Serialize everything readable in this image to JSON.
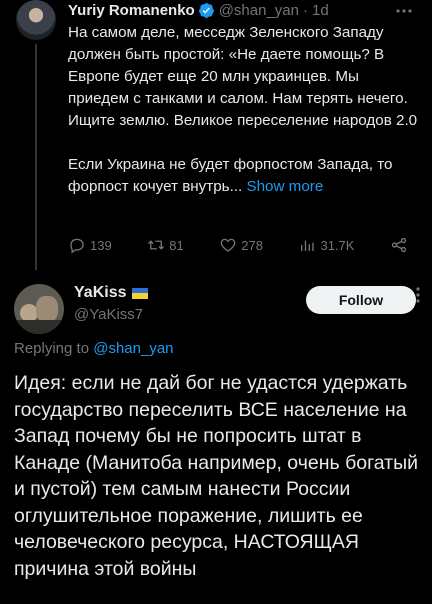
{
  "parent_tweet": {
    "author_name": "Yuriy Romanenko",
    "handle": "@shan_yan",
    "separator": "·",
    "time": "1d",
    "paragraph1": "На самом деле,  месседж Зеленского Западу должен быть простой: «Не даете помощь? В Европе будет еще 20 млн украинцев. Мы приедем с танками и салом. Нам терять нечего. Ищите землю. Великое переселение народов 2.0",
    "paragraph2": "Если Украина не будет форпостом Запада, то форпост кочует внутрь...",
    "show_more_label": "Show more",
    "actions": {
      "replies": "139",
      "retweets": "81",
      "likes": "278",
      "views": "31.7K"
    },
    "icons": [
      "verified-icon",
      "more-icon",
      "reply-icon",
      "retweet-icon",
      "like-icon",
      "views-icon",
      "share-icon"
    ]
  },
  "reply_tweet": {
    "author_name": "YaKiss",
    "flag": "ukraine-flag-icon",
    "handle": "@YaKiss7",
    "follow_label": "Follow",
    "replying_prefix": "Replying to",
    "replying_to": "@shan_yan",
    "text": "Идея: если не дай бог не удастся удержать государство переселить ВСЕ население на Запад почему бы не попросить штат в Канаде (Манитоба например, очень богатый и пустой) тем самым нанести России оглушительное поражение, лишить ее человеческого ресурса, НАСТОЯЩАЯ причина этой войны"
  },
  "colors": {
    "background": "#000000",
    "text": "#e7e9ea",
    "muted": "#71767b",
    "link": "#1d9bf0",
    "follow_bg": "#eff3f4"
  }
}
